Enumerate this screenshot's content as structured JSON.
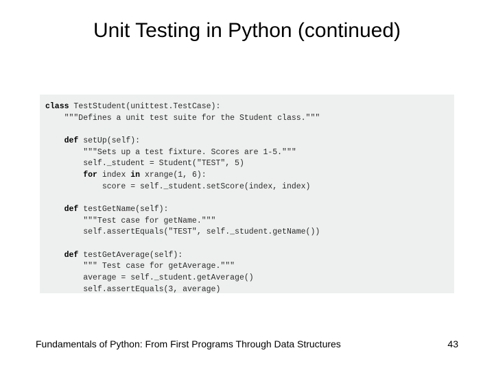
{
  "title": "Unit Testing in Python (continued)",
  "code": {
    "kw_class": "class",
    "l1": " TestStudent(unittest.TestCase):",
    "l2": "    \"\"\"Defines a unit test suite for the Student class.\"\"\"",
    "kw_def1": "def",
    "l3a": "    ",
    "l3b": " setUp(self):",
    "l4": "        \"\"\"Sets up a test fixture. Scores are 1-5.\"\"\"",
    "l5": "        self._student = Student(\"TEST\", 5)",
    "l6a": "        ",
    "kw_for": "for",
    "l6b": " index ",
    "kw_in": "in",
    "l6c": " xrange(1, 6):",
    "l7": "            score = self._student.setScore(index, index)",
    "kw_def2": "def",
    "l8a": "    ",
    "l8b": " testGetName(self):",
    "l9": "        \"\"\"Test case for getName.\"\"\"",
    "l10": "        self.assertEquals(\"TEST\", self._student.getName())",
    "kw_def3": "def",
    "l11a": "    ",
    "l11b": " testGetAverage(self):",
    "l12": "        \"\"\" Test case for getAverage.\"\"\"",
    "l13": "        average = self._student.getAverage()",
    "l14": "        self.assertEquals(3, average)"
  },
  "footer": "Fundamentals of Python: From First Programs Through Data Structures",
  "page": "43"
}
